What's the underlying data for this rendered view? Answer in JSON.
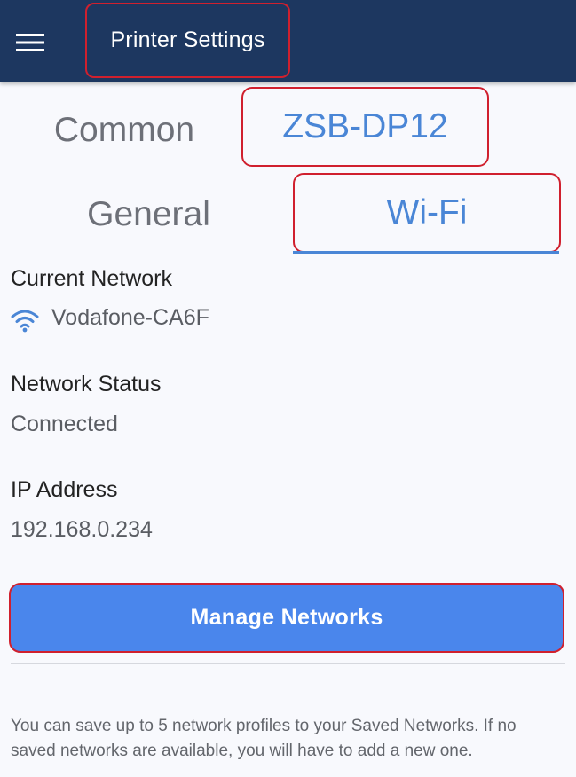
{
  "app_bar": {
    "menu_icon": "hamburger-menu-icon",
    "title": "Printer Settings",
    "background": "#1d3760"
  },
  "tabs_row1": [
    {
      "label": "Common",
      "active": false
    },
    {
      "label": "ZSB-DP12",
      "active": true
    }
  ],
  "tabs_row2": [
    {
      "label": "General",
      "active": false
    },
    {
      "label": "Wi-Fi",
      "active": true
    }
  ],
  "wifi": {
    "current_network_label": "Current Network",
    "current_network_icon": "wifi-icon",
    "current_network_value": "Vodafone-CA6F",
    "status_label": "Network Status",
    "status_value": "Connected",
    "ip_label": "IP Address",
    "ip_value": "192.168.0.234"
  },
  "manage_button": {
    "label": "Manage Networks",
    "color": "#4a86ec"
  },
  "note": "You can save up to 5 network profiles to your Saved Networks. If no saved networks are available, you will have to add a new one.",
  "accent_color": "#4a86d6",
  "highlight_color": "#d0202e"
}
